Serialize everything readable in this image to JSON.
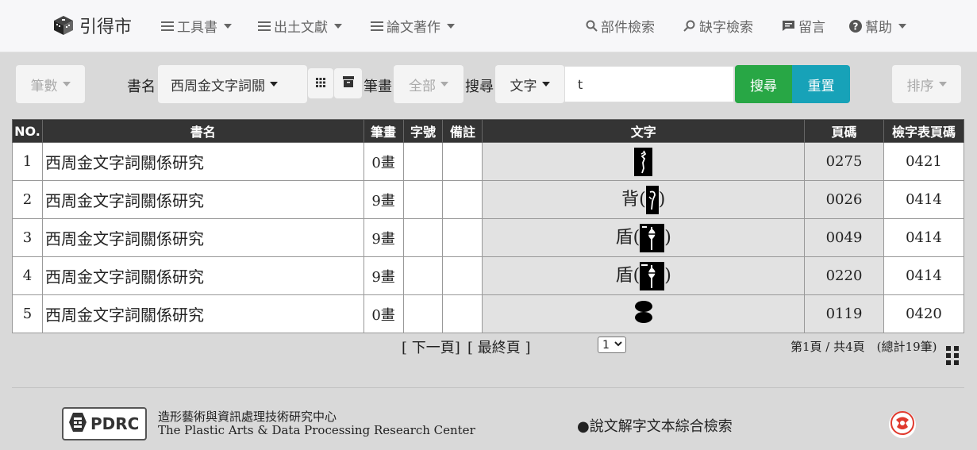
{
  "brand": {
    "name": "引得市"
  },
  "nav": {
    "left": [
      {
        "label": "工具書",
        "icon": "menu-icon"
      },
      {
        "label": "出土文獻",
        "icon": "menu-icon"
      },
      {
        "label": "論文著作",
        "icon": "menu-icon"
      }
    ],
    "right": [
      {
        "label": "部件檢索",
        "icon": "search-icon"
      },
      {
        "label": "缺字檢索",
        "icon": "search-plus-icon"
      },
      {
        "label": "留言",
        "icon": "comment-icon"
      },
      {
        "label": "幫助",
        "icon": "help-icon"
      }
    ]
  },
  "search": {
    "stroke_count_btn": "筆數",
    "book_label": "書名",
    "book_select": "西周金文字詞關",
    "stroke_label": "筆畫",
    "stroke_select": "全部",
    "search_label": "搜尋",
    "field_select": "文字",
    "query": "t",
    "search_btn": "搜尋",
    "reset_btn": "重置",
    "sort_btn": "排序"
  },
  "table": {
    "headers": [
      "NO.",
      "書名",
      "筆畫",
      "字號",
      "備註",
      "文字",
      "頁碼",
      "檢字表頁碼"
    ],
    "rows": [
      {
        "no": "1",
        "book": "西周金文字詞關係研究",
        "strokes": "0畫",
        "num": "",
        "note": "",
        "char_prefix": "",
        "char_open": "",
        "char_close": "",
        "page": "0275",
        "index_page": "0421"
      },
      {
        "no": "2",
        "book": "西周金文字詞關係研究",
        "strokes": "9畫",
        "num": "",
        "note": "",
        "char_prefix": "背",
        "char_open": "(",
        "char_close": ")",
        "page": "0026",
        "index_page": "0414"
      },
      {
        "no": "3",
        "book": "西周金文字詞關係研究",
        "strokes": "9畫",
        "num": "",
        "note": "",
        "char_prefix": "盾",
        "char_open": "(",
        "char_close": ")",
        "page": "0049",
        "index_page": "0414"
      },
      {
        "no": "4",
        "book": "西周金文字詞關係研究",
        "strokes": "9畫",
        "num": "",
        "note": "",
        "char_prefix": "盾",
        "char_open": "(",
        "char_close": ")",
        "page": "0220",
        "index_page": "0414"
      },
      {
        "no": "5",
        "book": "西周金文字詞關係研究",
        "strokes": "0畫",
        "num": "",
        "note": "",
        "char_prefix": "",
        "char_open": "",
        "char_close": "",
        "page": "0119",
        "index_page": "0420"
      }
    ]
  },
  "pager": {
    "next": "[ 下一頁]",
    "last": "[ 最終頁 ]",
    "current": "1",
    "info": "第1頁 / 共4頁　(總計19筆)"
  },
  "footer": {
    "logo_text": "PDRC",
    "org_zh": "造形藝術與資訊處理技術研究中心",
    "org_en": "The Plastic Arts & Data Processing Research Center",
    "link": "●說文解字文本綜合檢索"
  },
  "colors": {
    "search_green": "#28a745",
    "reset_teal": "#17a2b8",
    "table_header": "#343434",
    "badge_red": "#e03a2e"
  }
}
